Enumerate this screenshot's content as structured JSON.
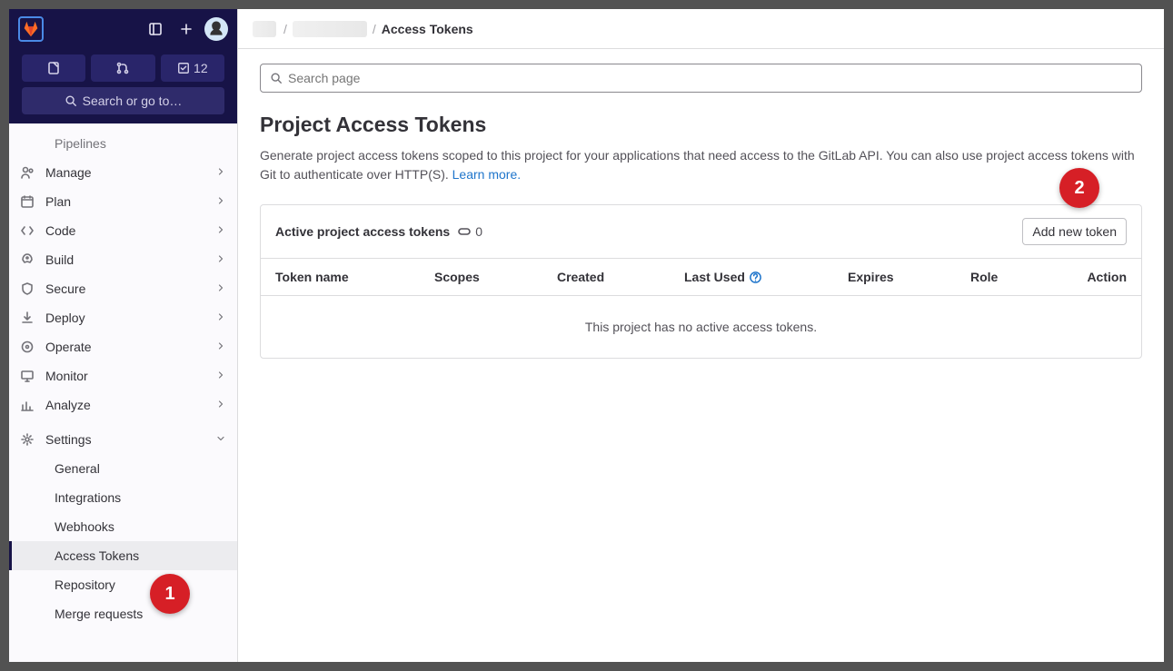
{
  "header": {
    "search_label": "Search or go to…",
    "todo_count": "12"
  },
  "breadcrumbs": {
    "current": "Access Tokens"
  },
  "sidebar": {
    "top_sub": "Pipelines",
    "items": [
      {
        "label": "Manage"
      },
      {
        "label": "Plan"
      },
      {
        "label": "Code"
      },
      {
        "label": "Build"
      },
      {
        "label": "Secure"
      },
      {
        "label": "Deploy"
      },
      {
        "label": "Operate"
      },
      {
        "label": "Monitor"
      },
      {
        "label": "Analyze"
      },
      {
        "label": "Settings"
      }
    ],
    "settings_sub": [
      {
        "label": "General"
      },
      {
        "label": "Integrations"
      },
      {
        "label": "Webhooks"
      },
      {
        "label": "Access Tokens",
        "active": true
      },
      {
        "label": "Repository"
      },
      {
        "label": "Merge requests"
      }
    ]
  },
  "page": {
    "search_placeholder": "Search page",
    "title": "Project Access Tokens",
    "description": "Generate project access tokens scoped to this project for your applications that need access to the GitLab API. You can also use project access tokens with Git to authenticate over HTTP(S). ",
    "learn_more": "Learn more.",
    "active_title": "Active project access tokens",
    "active_count": "0",
    "add_button": "Add new token",
    "columns": {
      "name": "Token name",
      "scopes": "Scopes",
      "created": "Created",
      "last_used": "Last Used",
      "expires": "Expires",
      "role": "Role",
      "action": "Action"
    },
    "empty": "This project has no active access tokens."
  },
  "callouts": {
    "one": "1",
    "two": "2"
  }
}
